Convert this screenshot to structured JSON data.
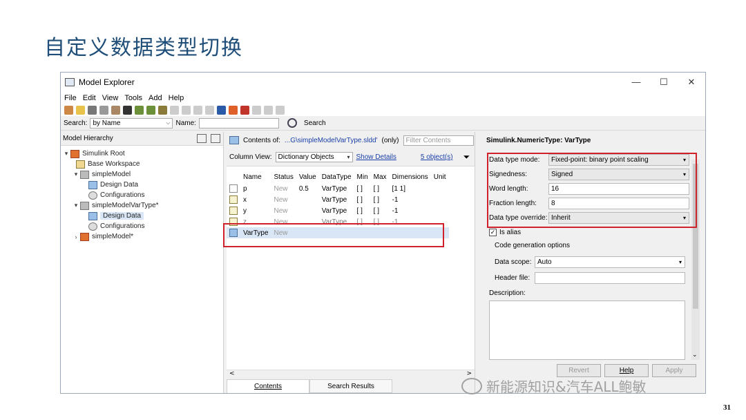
{
  "slide": {
    "title": "自定义数据类型切换",
    "page_number": "31",
    "watermark": "新能源知识&汽车ALL鲍敏"
  },
  "window": {
    "title": "Model Explorer",
    "controls": {
      "minimize": "—",
      "maximize": "☐",
      "close": "✕"
    }
  },
  "menu": [
    "File",
    "Edit",
    "View",
    "Tools",
    "Add",
    "Help"
  ],
  "searchbar": {
    "search_label": "Search:",
    "search_mode": "by Name",
    "name_label": "Name:",
    "search_button": "Search"
  },
  "hierarchy": {
    "header": "Model Hierarchy",
    "items": [
      {
        "label": "Simulink Root",
        "toggle": "▾"
      },
      {
        "label": "Base Workspace",
        "toggle": ""
      },
      {
        "label": "simpleModel",
        "toggle": "▾"
      },
      {
        "label": "Design Data",
        "toggle": ""
      },
      {
        "label": "Configurations",
        "toggle": ""
      },
      {
        "label": "simpleModelVarType*",
        "toggle": "▾"
      },
      {
        "label": "Design Data",
        "toggle": ""
      },
      {
        "label": "Configurations",
        "toggle": ""
      },
      {
        "label": "simpleModel*",
        "toggle": "›"
      }
    ]
  },
  "contents": {
    "contents_of_label": "Contents of:",
    "path": "...G\\simpleModelVarType.sldd'",
    "only": "(only)",
    "filter_placeholder": "Filter Contents",
    "column_view_label": "Column View:",
    "column_view_value": "Dictionary Objects",
    "show_details": "Show Details",
    "object_count": "5 object(s)",
    "columns": [
      "Name",
      "Status",
      "Value",
      "DataType",
      "Min",
      "Max",
      "Dimensions",
      "Unit"
    ],
    "rows": [
      {
        "name": "p",
        "status": "New",
        "value": "0.5",
        "datatype": "VarType",
        "min": "[ ]",
        "max": "[ ]",
        "dimensions": "[1 1]",
        "unit": ""
      },
      {
        "name": "x",
        "status": "New",
        "value": "",
        "datatype": "VarType",
        "min": "[ ]",
        "max": "[ ]",
        "dimensions": "-1",
        "unit": ""
      },
      {
        "name": "y",
        "status": "New",
        "value": "",
        "datatype": "VarType",
        "min": "[ ]",
        "max": "[ ]",
        "dimensions": "-1",
        "unit": ""
      },
      {
        "name": "z",
        "status": "New",
        "value": "",
        "datatype": "VarType",
        "min": "[ ]",
        "max": "[ ]",
        "dimensions": "-1",
        "unit": ""
      },
      {
        "name": "VarType",
        "status": "New",
        "value": "",
        "datatype": "",
        "min": "",
        "max": "",
        "dimensions": "",
        "unit": ""
      }
    ],
    "tabs": [
      "Contents",
      "Search Results"
    ]
  },
  "properties": {
    "title": "Simulink.NumericType: VarType",
    "data_type_mode_label": "Data type mode:",
    "data_type_mode": "Fixed-point: binary point scaling",
    "signedness_label": "Signedness:",
    "signedness": "Signed",
    "word_length_label": "Word length:",
    "word_length": "16",
    "fraction_length_label": "Fraction length:",
    "fraction_length": "8",
    "override_label": "Data type override:",
    "override": "Inherit",
    "is_alias_label": "Is alias",
    "codegen_label": "Code generation options",
    "data_scope_label": "Data scope:",
    "data_scope": "Auto",
    "header_file_label": "Header file:",
    "description_label": "Description:",
    "buttons": {
      "revert": "Revert",
      "help": "Help",
      "apply": "Apply"
    }
  },
  "colors": {
    "title": "#1f4e79",
    "highlight": "#d0202a",
    "selection": "#d9e6f5",
    "link": "#1a3fa8"
  }
}
